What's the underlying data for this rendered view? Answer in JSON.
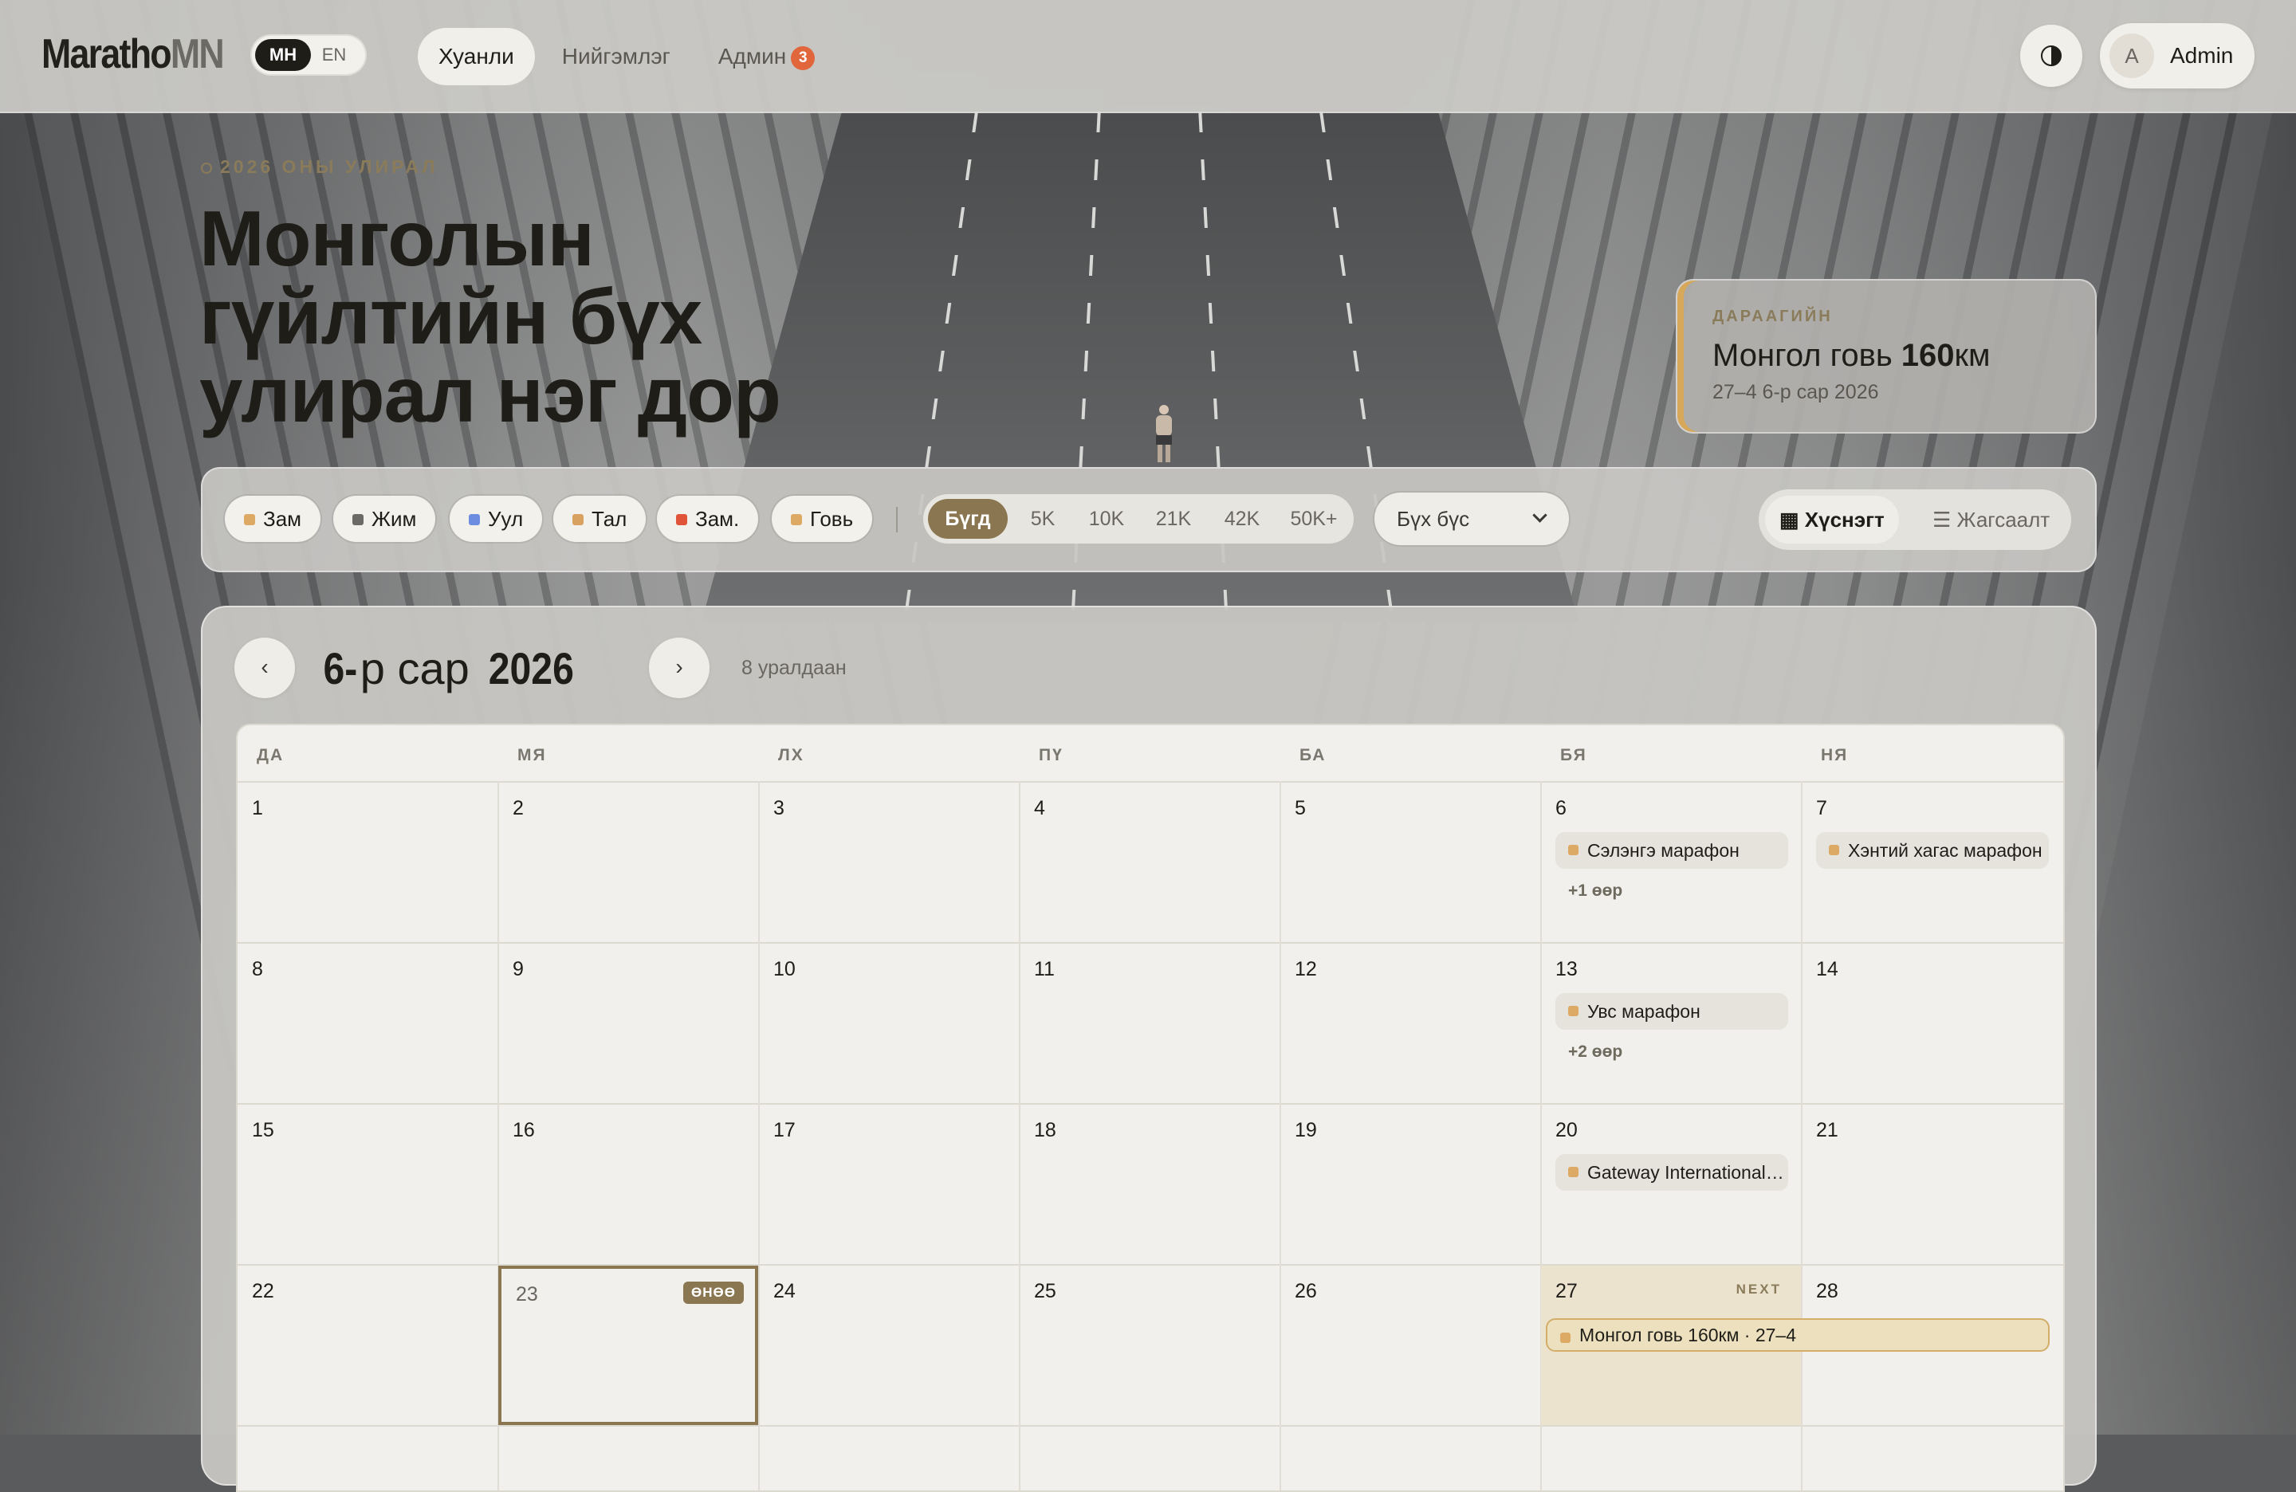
{
  "nav": {
    "logo_main": "Maratho",
    "logo_accent": "MN",
    "lang_active": "МН",
    "lang_other": "EN",
    "links": [
      "Хуанли",
      "Нийгэмлэг",
      "Админ"
    ],
    "admin_badge": "3",
    "user_initial": "A",
    "user_name": "Admin"
  },
  "hero": {
    "kicker": "2026 ОНЫ УЛИРАЛ",
    "title": "Монголын гүйлтийн бүх улирал нэг дор"
  },
  "next_race": {
    "label": "ДАРААГИЙН",
    "title": "Монгол говь ",
    "distance": "160",
    "unit": "км",
    "date": "27–4 6-р сар 2026"
  },
  "filters": {
    "categories": [
      {
        "label": "Зам",
        "color": "#dcaa65"
      },
      {
        "label": "Жим",
        "color": "#6b6a66"
      },
      {
        "label": "Уул",
        "color": "#6c8de0"
      },
      {
        "label": "Тал",
        "color": "#d9a160"
      },
      {
        "label": "Зам.",
        "color": "#e0553a"
      },
      {
        "label": "Говь",
        "color": "#dcaa65"
      }
    ],
    "distances": [
      "Бүгд",
      "5K",
      "10K",
      "21K",
      "42K",
      "50K+"
    ],
    "type_select": "Бүх бүс",
    "view_calendar": "▦ Хүснэгт",
    "view_list": "☰ Жагсаалт"
  },
  "calendar": {
    "month_num": "6-",
    "month_word": "р сар",
    "year": "2026",
    "count": "8 уралдаан",
    "prev": "‹",
    "next": "›",
    "weekdays": [
      "ДА",
      "МЯ",
      "ЛХ",
      "ПҮ",
      "БА",
      "БЯ",
      "НЯ"
    ],
    "today_tag": "ӨНӨӨ",
    "next_tag": "NEXT",
    "events": {
      "6": {
        "title": "Сэлэнгэ марафон",
        "more": "+1 өөр"
      },
      "7": {
        "title": "Хэнтий хагас марафон"
      },
      "13": {
        "title": "Увс марафон",
        "more": "+2 өөр"
      },
      "20": {
        "title": "Gateway International Marathon"
      },
      "27": {
        "title": "Монгол говь 160км · 27–4"
      }
    }
  },
  "colors": {
    "accent": "#8a7650",
    "badge": "#e2663c",
    "event_swatch": "#dcaa65"
  }
}
